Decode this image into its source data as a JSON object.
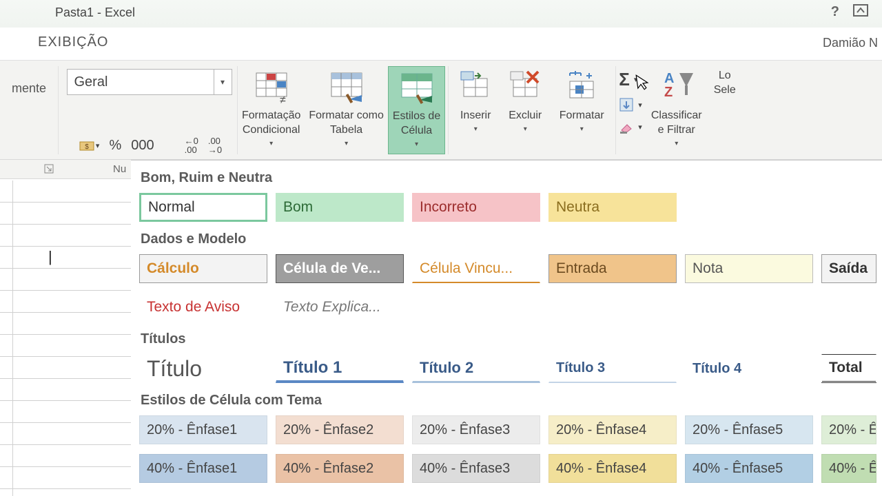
{
  "title": "Pasta1 - Excel",
  "tab": "EXIBIÇÃO",
  "user": "Damião N",
  "ribbon": {
    "left_cut": "mente",
    "number_format": "Geral",
    "percent": "%",
    "thousand": "000",
    "inc_dec1": "←,0\n,00",
    "inc_dec2": ",00\n→,0",
    "cond_fmt": "Formatação\nCondicional",
    "fmt_table": "Formatar como\nTabela",
    "cell_styles": "Estilos de\nCélula",
    "insert": "Inserir",
    "delete": "Excluir",
    "format": "Formatar",
    "sort_filter": "Classificar\ne Filtrar",
    "find_select": "Lo\nSele"
  },
  "launcher": {
    "label": "Nu"
  },
  "gallery": {
    "cat1": "Bom, Ruim e Neutra",
    "row1": {
      "normal": "Normal",
      "bom": "Bom",
      "incorreto": "Incorreto",
      "neutra": "Neutra"
    },
    "cat2": "Dados e Modelo",
    "row2": {
      "calculo": "Cálculo",
      "celulave": "Célula de Ve...",
      "celulavinc": "Célula Vincu...",
      "entrada": "Entrada",
      "nota": "Nota",
      "saida": "Saída"
    },
    "row2b": {
      "aviso": "Texto de Aviso",
      "explic": "Texto Explica..."
    },
    "cat3": "Títulos",
    "row3": {
      "titulo": "Título",
      "t1": "Título 1",
      "t2": "Título 2",
      "t3": "Título 3",
      "t4": "Título 4",
      "total": "Total"
    },
    "cat4": "Estilos de Célula com Tema",
    "row4": {
      "e1": "20% - Ênfase1",
      "e2": "20% - Ênfase2",
      "e3": "20% - Ênfase3",
      "e4": "20% - Ênfase4",
      "e5": "20% - Ênfase5",
      "e6": "20% - Ê"
    },
    "row5": {
      "e1": "40% - Ênfase1",
      "e2": "40% - Ênfase2",
      "e3": "40% - Ênfase3",
      "e4": "40% - Ênfase4",
      "e5": "40% - Ênfase5",
      "e6": "40% - Ê"
    }
  }
}
